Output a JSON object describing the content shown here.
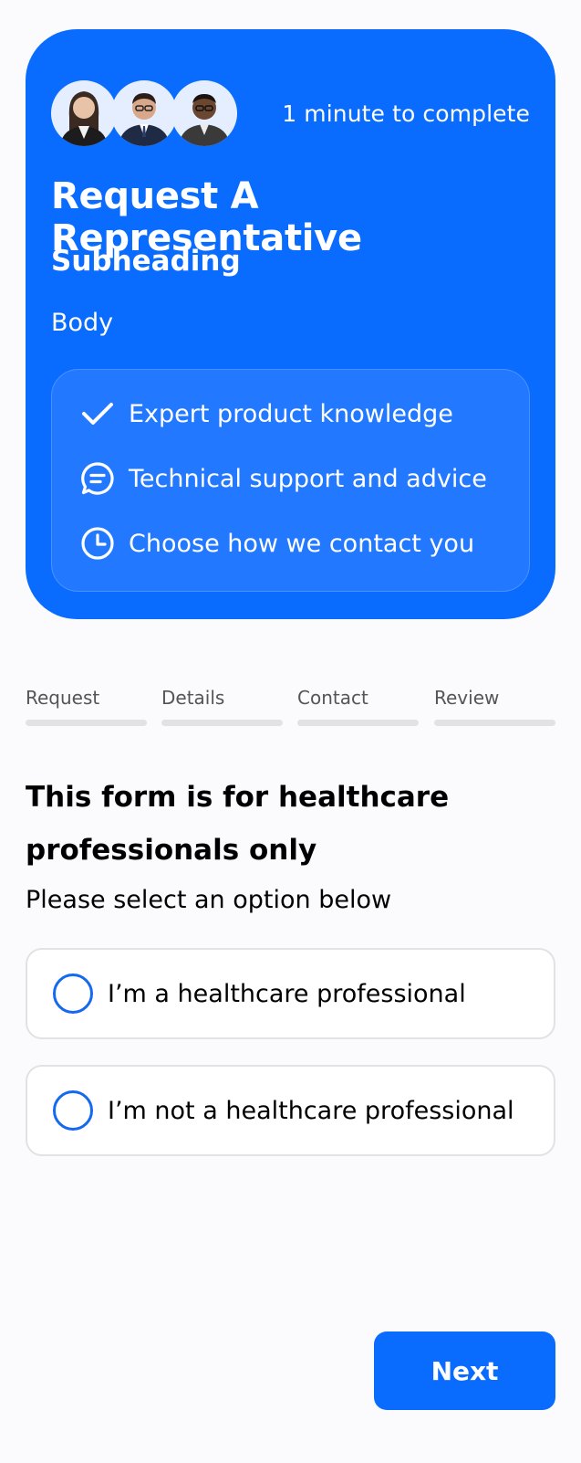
{
  "hero": {
    "time_to_complete": "1 minute to complete",
    "title": "Request A Representative",
    "subheading": "Subheading",
    "body": "Body",
    "features": [
      {
        "icon": "check-icon",
        "label": "Expert product knowledge"
      },
      {
        "icon": "chat-icon",
        "label": "Technical support and advice"
      },
      {
        "icon": "clock-icon",
        "label": "Choose how we contact you"
      }
    ],
    "colors": {
      "background": "#0A6CFF",
      "feature_panel": "#2279FF"
    }
  },
  "steps": [
    {
      "label": "Request"
    },
    {
      "label": "Details"
    },
    {
      "label": "Contact"
    },
    {
      "label": "Review"
    }
  ],
  "question": {
    "title": "This form is for healthcare professionals only",
    "instruction": "Please select an option below",
    "options": [
      {
        "label": "I’m a healthcare professional",
        "selected": false
      },
      {
        "label": "I’m not a healthcare professional",
        "selected": false
      }
    ]
  },
  "actions": {
    "next_label": "Next"
  },
  "colors": {
    "accent": "#0A6CFF",
    "page_bg": "#FBFBFE",
    "radio_border": "#1668F0"
  }
}
